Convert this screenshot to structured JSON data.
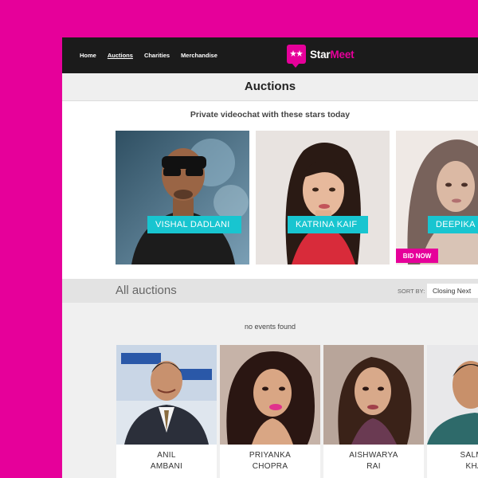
{
  "nav": {
    "links": [
      "Home",
      "Auctions",
      "Charities",
      "Merchandise"
    ],
    "active": "Auctions"
  },
  "logo": {
    "part1": "Star",
    "part2": "Meet",
    "icon": "chat-bubble-stars-icon"
  },
  "page": {
    "title": "Auctions",
    "subtitle": "Private videochat with these stars today"
  },
  "featured": [
    {
      "name": "VISHAL DADLANI"
    },
    {
      "name": "KATRINA KAIF"
    },
    {
      "name": "DEEPIKA PADUKONE",
      "bid_label": "BID NOW"
    }
  ],
  "all_auctions": {
    "heading": "All auctions",
    "sort_label": "SORT BY:",
    "sort_value": "Closing Next",
    "empty_text": "no events found"
  },
  "people": [
    {
      "first": "ANIL",
      "last": "AMBANI"
    },
    {
      "first": "PRIYANKA",
      "last": "CHOPRA"
    },
    {
      "first": "AISHWARYA",
      "last": "RAI"
    },
    {
      "first": "SALMAN",
      "last": "KHAN"
    }
  ],
  "colors": {
    "brand": "#e6009a",
    "accent": "#18c5d0",
    "nav_bg": "#1b1b1b"
  }
}
